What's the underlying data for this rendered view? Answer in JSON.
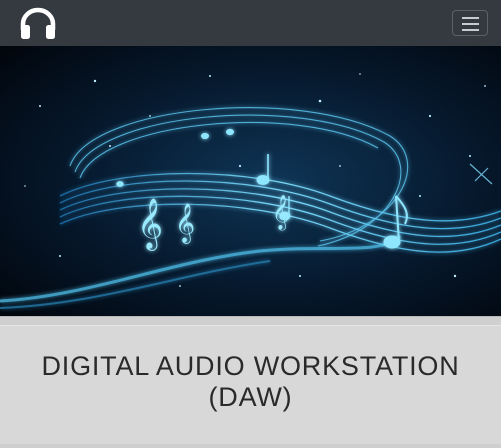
{
  "navbar": {
    "logo_icon": "headphones-icon",
    "menu_icon": "hamburger-menu-icon",
    "background": "#343a40"
  },
  "hero": {
    "image": "music-notes-staff-swirl",
    "accent": "#3fb6e8"
  },
  "title": {
    "line1": "DIGITAL AUDIO WORKSTATION",
    "line2": "(DAW)"
  }
}
